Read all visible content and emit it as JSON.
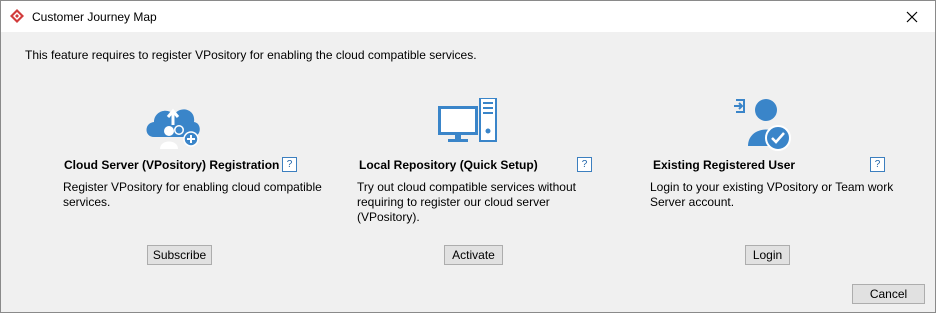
{
  "window": {
    "title": "Customer Journey Map"
  },
  "intro_text": "This feature requires to register VPository for enabling the cloud compatible services.",
  "options": [
    {
      "title": "Cloud Server (VPository) Registration",
      "help": "?",
      "description": [
        "Register VPository for enabling cloud compatible",
        "services."
      ],
      "button": "Subscribe",
      "icon": "cloud-users-icon"
    },
    {
      "title": "Local Repository (Quick Setup)",
      "help": "?",
      "description": [
        "Try out cloud compatible services without",
        "requiring to register our cloud server",
        "(VPository)."
      ],
      "button": "Activate",
      "icon": "computer-server-icon"
    },
    {
      "title": "Existing Registered User",
      "help": "?",
      "description": [
        "Login to your existing VPository or Team work",
        "Server account."
      ],
      "button": "Login",
      "icon": "user-login-icon"
    }
  ],
  "footer": {
    "cancel": "Cancel"
  },
  "colors": {
    "icon_blue": "#3a85c9",
    "app_red": "#d23b3b"
  }
}
